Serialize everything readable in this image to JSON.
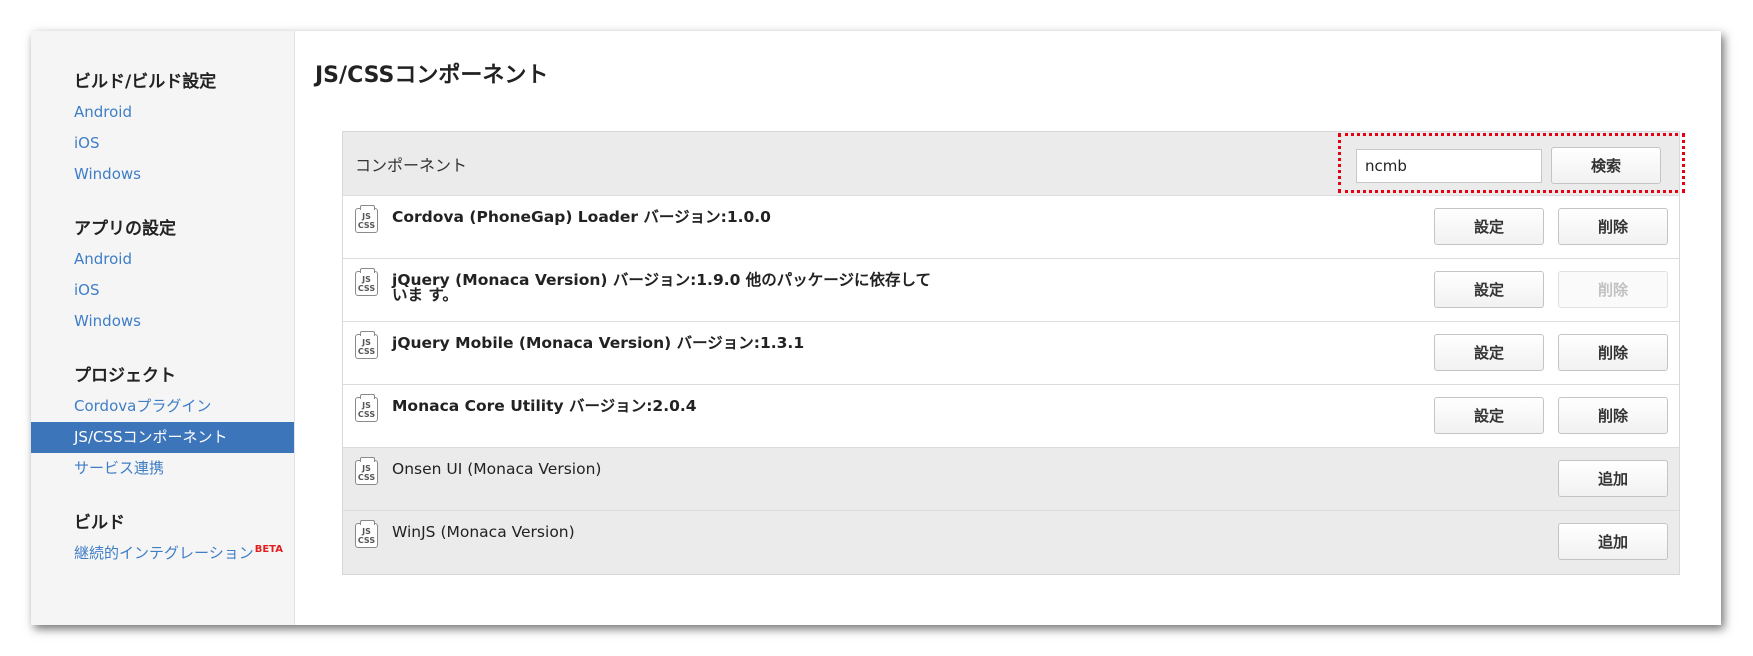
{
  "sidebar": {
    "sections": [
      {
        "heading": "ビルド/ビルド設定",
        "items": [
          "Android",
          "iOS",
          "Windows"
        ]
      },
      {
        "heading": "アプリの設定",
        "items": [
          "Android",
          "iOS",
          "Windows"
        ]
      },
      {
        "heading": "プロジェクト",
        "items": [
          "Cordovaプラグイン",
          "JS/CSSコンポーネント",
          "サービス連携"
        ]
      },
      {
        "heading": "ビルド",
        "items": [
          "継続的インテグレーション"
        ],
        "badge": "BETA"
      }
    ],
    "active_item": "JS/CSSコンポーネント"
  },
  "main": {
    "title": "JS/CSSコンポーネント",
    "table": {
      "header_label": "コンポーネント",
      "search": {
        "value": "ncmb",
        "button_label": "検索"
      },
      "icon_text": "JS CSS",
      "rows": [
        {
          "name": "Cordova (PhoneGap) Loader バージョン:1.0.0",
          "status": "installed",
          "settings_label": "設定",
          "delete_label": "削除",
          "delete_enabled": true
        },
        {
          "name": "jQuery (Monaca Version) バージョン:1.9.0 他のパッケージに依存していま す。",
          "status": "installed",
          "settings_label": "設定",
          "delete_label": "削除",
          "delete_enabled": false
        },
        {
          "name": "jQuery Mobile (Monaca Version) バージョン:1.3.1",
          "status": "installed",
          "settings_label": "設定",
          "delete_label": "削除",
          "delete_enabled": true
        },
        {
          "name": "Monaca Core Utility バージョン:2.0.4",
          "status": "installed",
          "settings_label": "設定",
          "delete_label": "削除",
          "delete_enabled": true
        },
        {
          "name": "Onsen UI (Monaca Version)",
          "status": "available",
          "add_label": "追加"
        },
        {
          "name": "WinJS (Monaca Version)",
          "status": "available",
          "add_label": "追加"
        }
      ]
    }
  },
  "colors": {
    "link": "#3f7ec6",
    "active_bg": "#3d75bb",
    "highlight_border": "#e60012",
    "beta": "#e02020"
  }
}
